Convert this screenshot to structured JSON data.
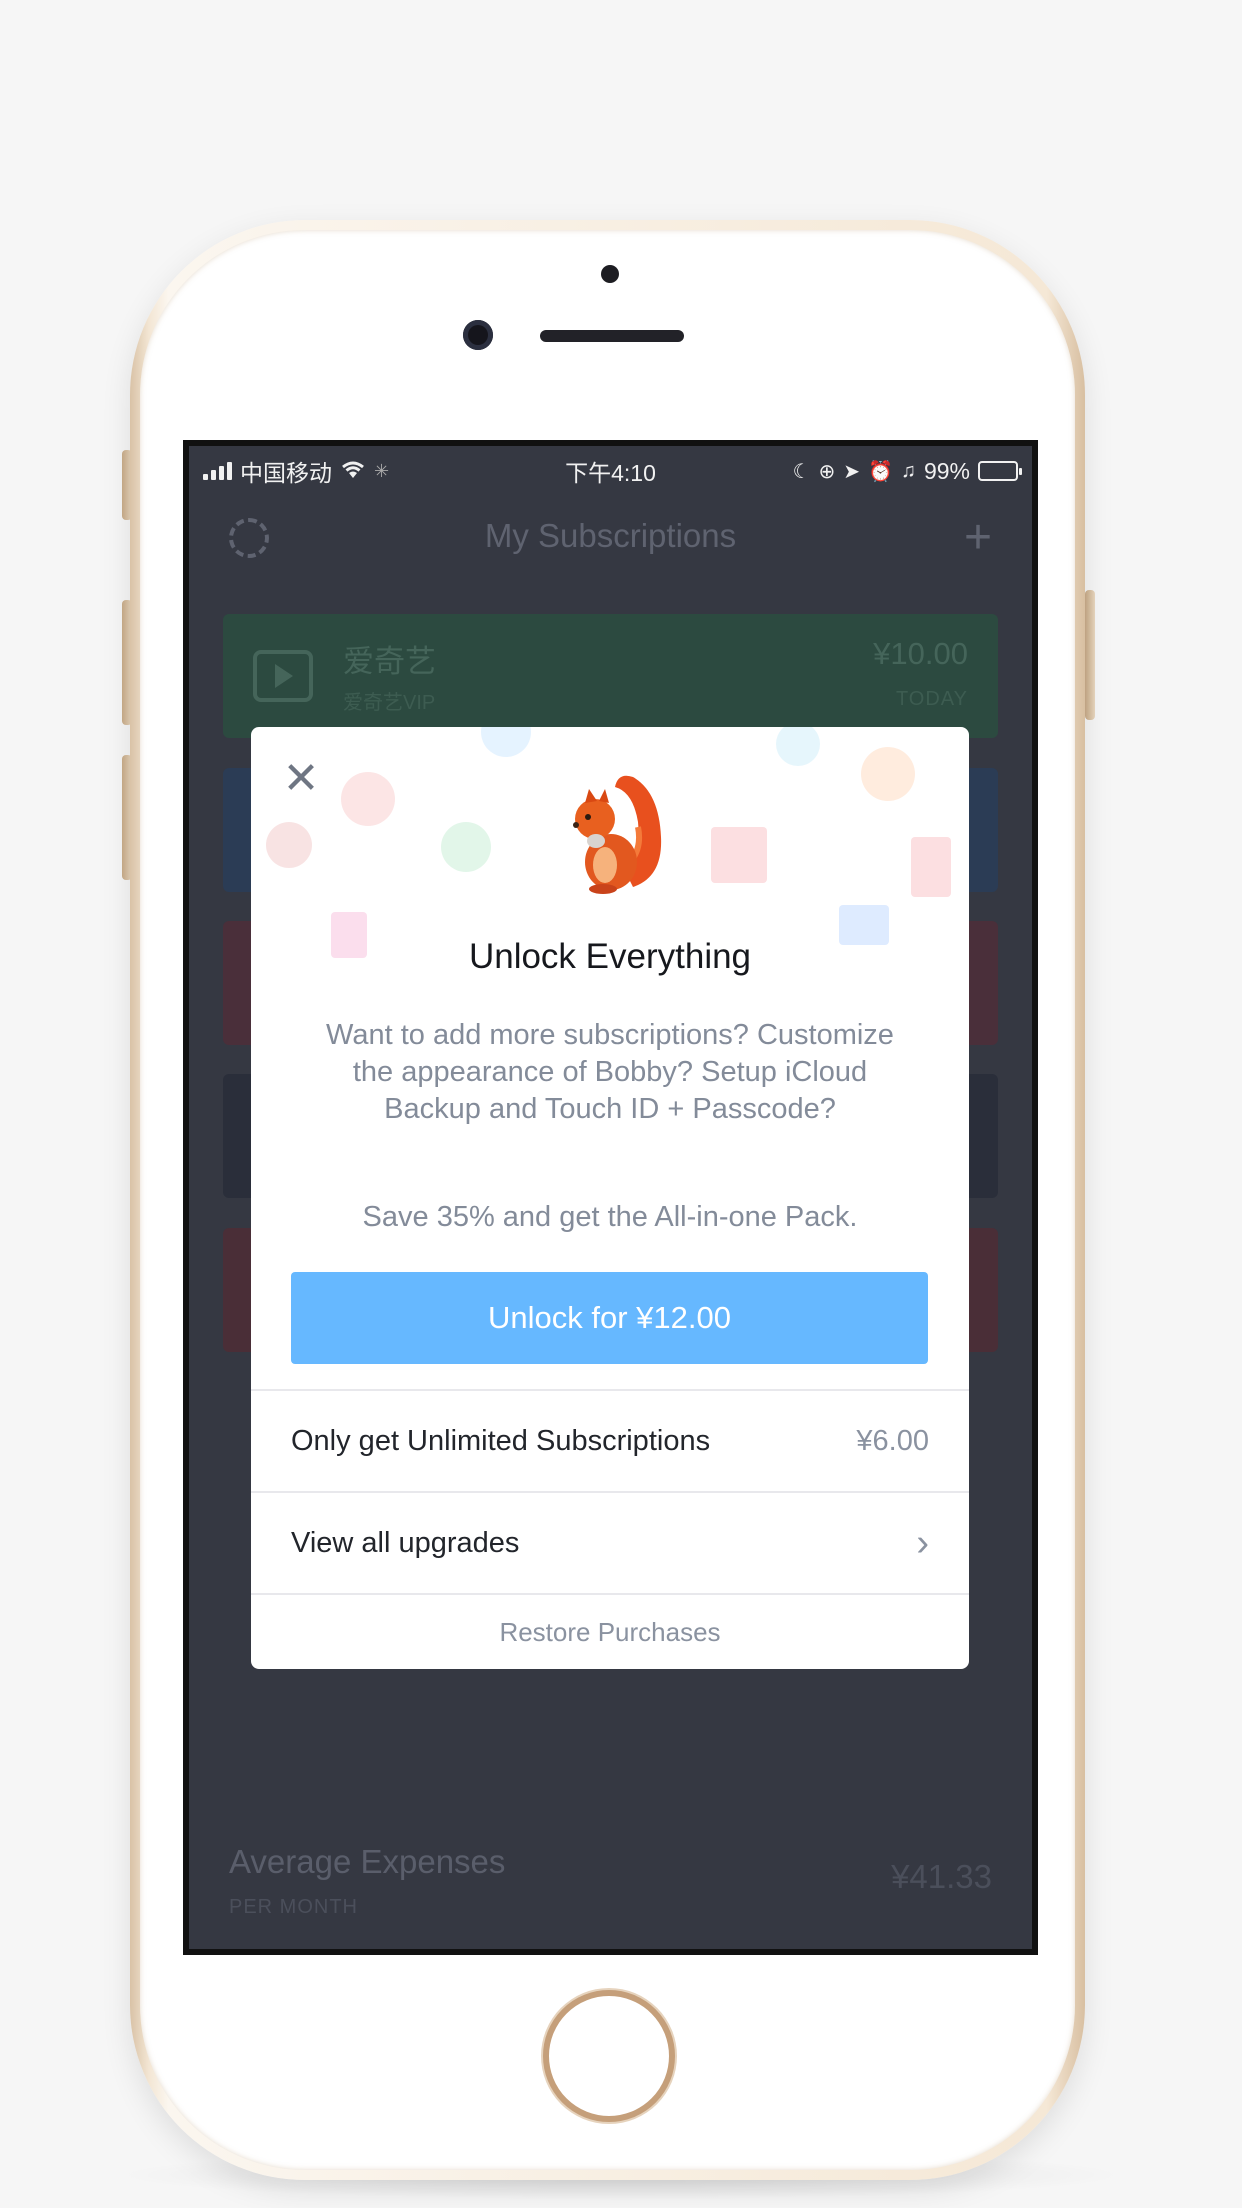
{
  "status_bar": {
    "carrier": "中国移动",
    "time": "下午4:10",
    "battery": "99%",
    "battery_level": 0.99
  },
  "nav": {
    "title": "My Subscriptions",
    "plus": "+"
  },
  "background_cards": [
    {
      "title": "爱奇艺",
      "subtitle": "爱奇艺VIP",
      "price": "¥10.00",
      "date": "TODAY"
    }
  ],
  "footer": {
    "title": "Average Expenses",
    "subtitle": "PER MONTH",
    "amount": "¥41.33"
  },
  "modal": {
    "close": "✕",
    "title": "Unlock Everything",
    "body": "Want to add more subscriptions? Customize the appearance of Bobby? Setup iCloud Backup and Touch ID + Passcode?",
    "save": "Save 35% and get the All-in-one Pack.",
    "unlock_button": "Unlock for ¥12.00",
    "rows": [
      {
        "label": "Only get Unlimited Subscriptions",
        "price": "¥6.00"
      },
      {
        "label": "View all upgrades",
        "chevron": "›"
      }
    ],
    "restore": "Restore Purchases"
  },
  "colors": {
    "accent": "#66b8ff",
    "screen_bg": "#353842",
    "modal_bg": "#ffffff"
  }
}
